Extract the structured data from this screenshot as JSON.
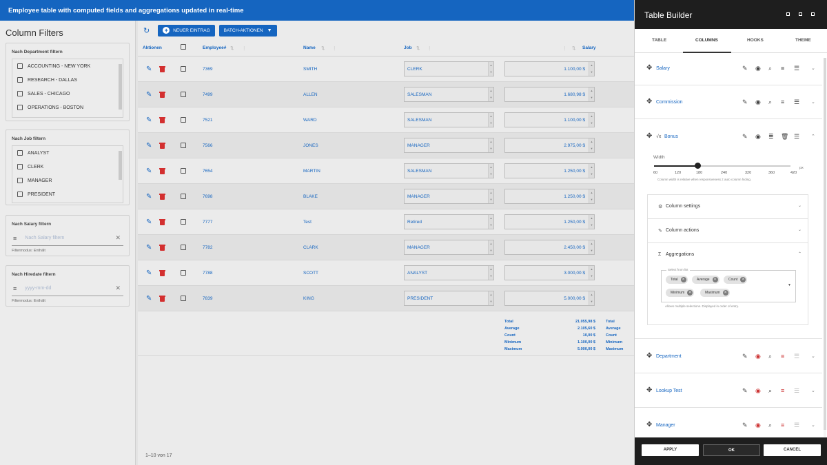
{
  "app": {
    "title": "Employee table with computed fields and aggregations updated in real-time"
  },
  "filters": {
    "heading": "Column Filters",
    "department": {
      "title": "Nach Department filtern",
      "options": [
        "ACCOUNTING - NEW YORK",
        "RESEARCH - DALLAS",
        "SALES - CHICAGO",
        "OPERATIONS - BOSTON"
      ]
    },
    "job": {
      "title": "Nach Job filtern",
      "options": [
        "ANALYST",
        "CLERK",
        "MANAGER",
        "PRESIDENT"
      ]
    },
    "salary": {
      "title": "Nach Salary filtern",
      "placeholder": "Nach Salary filtern",
      "mode": "Filtermodus: Enthält"
    },
    "hiredate": {
      "title": "Nach Hiredate filtern",
      "placeholder": "yyyy-mm-dd",
      "mode": "Filtermodus: Enthält"
    }
  },
  "toolbar": {
    "new_label": "NEUER EINTRAG",
    "batch_label": "BATCH-AKTIONEN"
  },
  "table": {
    "headers": {
      "actions": "Aktionen",
      "employee": "Employee#",
      "name": "Name",
      "job": "Job",
      "salary": "Salary"
    },
    "rows": [
      {
        "id": "7369",
        "name": "SMITH",
        "job": "CLERK",
        "salary": "1.100,00 $"
      },
      {
        "id": "7499",
        "name": "ALLEN",
        "job": "SALESMAN",
        "salary": "1.680,98 $"
      },
      {
        "id": "7521",
        "name": "WARD",
        "job": "SALESMAN",
        "salary": "1.100,00 $"
      },
      {
        "id": "7566",
        "name": "JONES",
        "job": "MANAGER",
        "salary": "2.975,00 $"
      },
      {
        "id": "7654",
        "name": "MARTIN",
        "job": "SALESMAN",
        "salary": "1.250,00 $"
      },
      {
        "id": "7698",
        "name": "BLAKE",
        "job": "MANAGER",
        "salary": "1.250,00 $"
      },
      {
        "id": "7777",
        "name": "Test",
        "job": "Retired",
        "salary": "1.250,00 $"
      },
      {
        "id": "7782",
        "name": "CLARK",
        "job": "MANAGER",
        "salary": "2.450,00 $"
      },
      {
        "id": "7788",
        "name": "SCOTT",
        "job": "ANALYST",
        "salary": "3.000,00 $"
      },
      {
        "id": "7839",
        "name": "KING",
        "job": "PRESIDENT",
        "salary": "5.000,00 $"
      }
    ],
    "aggregations": [
      {
        "label": "Total",
        "value": "21.055,98 $"
      },
      {
        "label": "Average",
        "value": "2.105,60 $"
      },
      {
        "label": "Count",
        "value": "10,00 $"
      },
      {
        "label": "Minimum",
        "value": "1.100,00 $"
      },
      {
        "label": "Maximum",
        "value": "5.000,00 $"
      }
    ],
    "aggregations_next": [
      "Total",
      "Average",
      "Count",
      "Minimum",
      "Maximum"
    ],
    "pagination": "1–10 von 17"
  },
  "builder": {
    "title": "Table Builder",
    "tabs": [
      "TABLE",
      "COLUMNS",
      "HOOKS",
      "THEME"
    ],
    "columns": {
      "salary": "Salary",
      "commission": "Commission",
      "bonus": "Bonus",
      "bonus_prefix": "√x",
      "department": "Department",
      "lookup": "Lookup Test",
      "manager": "Manager"
    },
    "width": {
      "label": "Width",
      "value": 180,
      "min": 60,
      "max": 420,
      "ticks": [
        "60",
        "120",
        "180",
        "240",
        "320",
        "360",
        "420"
      ],
      "unit": "px",
      "hint": "Column width is relative when responsiveness ≠ auto column hiding."
    },
    "sections": {
      "settings": "Column settings",
      "actions": "Column actions",
      "aggregations": "Aggregations"
    },
    "multiselect": {
      "label": "Select from list",
      "chips": [
        "Total",
        "Average",
        "Count",
        "Minimum",
        "Maximum"
      ],
      "hint": "Allows multiple selections. Displayed in order of entry."
    },
    "footer": {
      "apply": "APPLY",
      "ok": "OK",
      "cancel": "CANCEL"
    }
  },
  "colors": {
    "accent": "#1565c0",
    "delete": "#d32f2f",
    "panel_dark": "#1e1e1e"
  }
}
